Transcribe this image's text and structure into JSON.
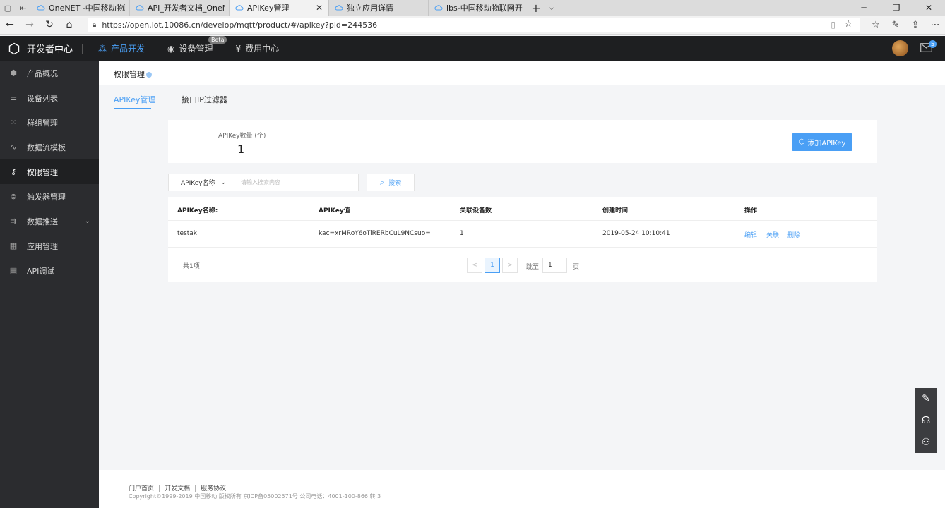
{
  "browser": {
    "tabs": [
      {
        "title": "OneNET -中国移动物联网开",
        "active": false
      },
      {
        "title": "API_开发者文档_OneNET",
        "active": false
      },
      {
        "title": "APIKey管理",
        "active": true
      },
      {
        "title": "独立应用详情",
        "active": false
      },
      {
        "title": "lbs-中国移动物联网开放平台",
        "active": false
      }
    ],
    "close_glyph": "✕",
    "new_tab_glyph": "+",
    "url": "https://open.iot.10086.cn/develop/mqtt/product/#/apikey?pid=244536"
  },
  "topnav": {
    "logo_text": "开发者中心",
    "items": [
      {
        "label": "产品开发",
        "active": true,
        "icon": "cubes-icon"
      },
      {
        "label": "设备管理",
        "active": false,
        "icon": "disc-icon",
        "badge": "Beta"
      },
      {
        "label": "费用中心",
        "active": false,
        "icon": "yuan-icon"
      }
    ],
    "mail_count": "5"
  },
  "sidebar": {
    "items": [
      {
        "label": "产品概况",
        "icon": "cube-icon",
        "active": false
      },
      {
        "label": "设备列表",
        "icon": "list-icon",
        "active": false
      },
      {
        "label": "群组管理",
        "icon": "grid-dots-icon",
        "active": false
      },
      {
        "label": "数据流模板",
        "icon": "wave-icon",
        "active": false
      },
      {
        "label": "权限管理",
        "icon": "key-icon",
        "active": true
      },
      {
        "label": "触发器管理",
        "icon": "trigger-icon",
        "active": false
      },
      {
        "label": "数据推送",
        "icon": "push-icon",
        "active": false,
        "expandable": true
      },
      {
        "label": "应用管理",
        "icon": "apps-icon",
        "active": false
      },
      {
        "label": "API调试",
        "icon": "api-icon",
        "active": false
      }
    ]
  },
  "page": {
    "title": "权限管理",
    "subtabs": [
      {
        "label": "APIKey管理",
        "active": true
      },
      {
        "label": "接口IP过滤器",
        "active": false
      }
    ],
    "count_label": "APIKey数量 (个)",
    "count_value": "1",
    "add_button": "添加APIKey",
    "search": {
      "select_value": "APIKey名称",
      "placeholder": "请输入搜索内容",
      "button": "搜索"
    },
    "table": {
      "headers": [
        "APIKey名称:",
        "APIKey值",
        "关联设备数",
        "创建时间",
        "操作"
      ],
      "rows": [
        {
          "name": "testak",
          "value": "kac=xrMRoY6oTiRERbCuL9NCsuo=",
          "devices": "1",
          "created": "2019-05-24 10:10:41",
          "ops": [
            "编辑",
            "关联",
            "删除"
          ]
        }
      ]
    },
    "pager": {
      "total": "共1项",
      "prev": "<",
      "current": "1",
      "next": ">",
      "goto_label": "跳至",
      "goto_value": "1",
      "page_unit": "页"
    }
  },
  "footer": {
    "links": [
      "门户首页",
      "开发文档",
      "服务协议"
    ],
    "copyright": "Copyright©1999-2019 中国移动 版权所有 京ICP备05002571号 公司电话：4001-100-866 转 3"
  },
  "colors": {
    "accent": "#4a9ff5",
    "topnav_bg": "#1e1f21",
    "sidebar_bg": "#2b2c2f"
  }
}
